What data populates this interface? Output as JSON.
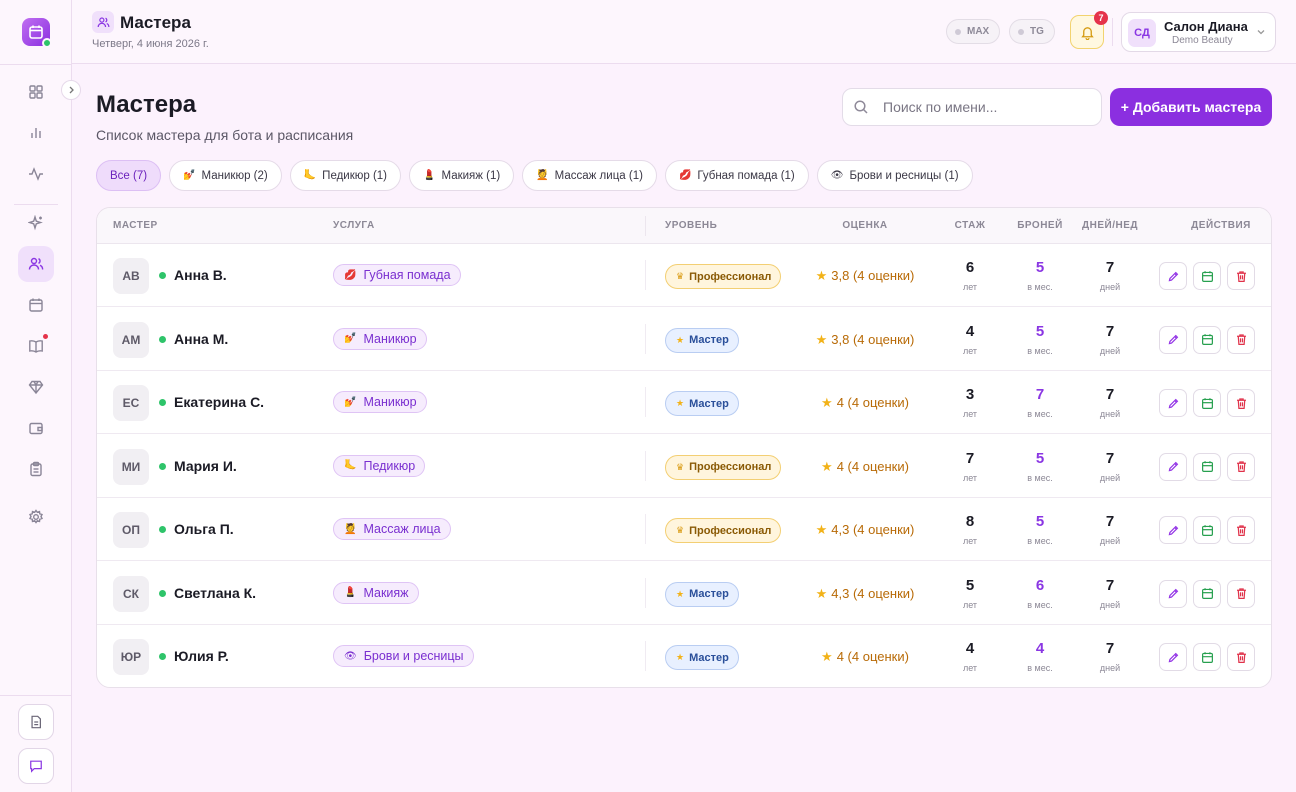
{
  "topbar": {
    "title": "Мастера",
    "date": "Четверг, 4 июня 2026 г.",
    "status_pills": [
      "MAX",
      "TG"
    ],
    "notifications_count": "7",
    "user": {
      "initials": "СД",
      "name": "Салон Диана",
      "subtitle": "Demo Beauty"
    }
  },
  "sidebar": {
    "nav_icons": [
      "dashboard-icon",
      "bar-chart-icon",
      "activity-icon",
      "sparkles-icon",
      "users-icon",
      "calendar-icon",
      "book-icon",
      "diamond-icon",
      "wallet-icon",
      "clipboard-icon",
      "settings-icon"
    ],
    "active": "users-icon",
    "bottom_icons": [
      "document-icon",
      "chat-icon"
    ]
  },
  "page": {
    "title": "Мастера",
    "subtitle": "Список мастера для бота и расписания",
    "search_placeholder": "Поиск по имени...",
    "add_button": "+ Добавить мастера"
  },
  "filters": [
    {
      "emoji": "",
      "label": "Все (7)",
      "active": true
    },
    {
      "emoji": "💅",
      "label": "Маникюр (2)"
    },
    {
      "emoji": "🦶",
      "label": "Педикюр (1)"
    },
    {
      "emoji": "💄",
      "label": "Макияж (1)"
    },
    {
      "emoji": "💆",
      "label": "Массаж лица (1)"
    },
    {
      "emoji": "💋",
      "label": "Губная помада (1)"
    },
    {
      "emoji": "👁",
      "label": "Брови и ресницы (1)"
    }
  ],
  "table": {
    "columns": [
      "МАСТЕР",
      "УСЛУГА",
      "УРОВЕНЬ",
      "ОЦЕНКА",
      "СТАЖ",
      "БРОНЕЙ",
      "ДНЕЙ/НЕД",
      "ДЕЙСТВИЯ"
    ],
    "units": {
      "experience": "лет",
      "bookings": "в мес.",
      "days": "дней"
    },
    "rows": [
      {
        "initials": "АВ",
        "name": "Анна В.",
        "service_emoji": "💋",
        "service": "Губная помада",
        "level": "Профессионал",
        "level_type": "pro",
        "rating": "3,8 (4 оценки)",
        "experience": "6",
        "bookings": "5",
        "days": "7"
      },
      {
        "initials": "АМ",
        "name": "Анна М.",
        "service_emoji": "💅",
        "service": "Маникюр",
        "level": "Мастер",
        "level_type": "master",
        "rating": "3,8 (4 оценки)",
        "experience": "4",
        "bookings": "5",
        "days": "7"
      },
      {
        "initials": "ЕС",
        "name": "Екатерина С.",
        "service_emoji": "💅",
        "service": "Маникюр",
        "level": "Мастер",
        "level_type": "master",
        "rating": "4 (4 оценки)",
        "experience": "3",
        "bookings": "7",
        "days": "7"
      },
      {
        "initials": "МИ",
        "name": "Мария И.",
        "service_emoji": "🦶",
        "service": "Педикюр",
        "level": "Профессионал",
        "level_type": "pro",
        "rating": "4 (4 оценки)",
        "experience": "7",
        "bookings": "5",
        "days": "7"
      },
      {
        "initials": "ОП",
        "name": "Ольга П.",
        "service_emoji": "💆",
        "service": "Массаж лица",
        "level": "Профессионал",
        "level_type": "pro",
        "rating": "4,3 (4 оценки)",
        "experience": "8",
        "bookings": "5",
        "days": "7"
      },
      {
        "initials": "СК",
        "name": "Светлана К.",
        "service_emoji": "💄",
        "service": "Макияж",
        "level": "Мастер",
        "level_type": "master",
        "rating": "4,3 (4 оценки)",
        "experience": "5",
        "bookings": "6",
        "days": "7"
      },
      {
        "initials": "ЮР",
        "name": "Юлия Р.",
        "service_emoji": "👁",
        "service": "Брови и ресницы",
        "level": "Мастер",
        "level_type": "master",
        "rating": "4 (4 оценки)",
        "experience": "4",
        "bookings": "4",
        "days": "7"
      }
    ]
  },
  "colors": {
    "accent": "#8b2fe0",
    "online": "#2ec46a",
    "danger": "#e0324a",
    "rating": "#b86a06"
  }
}
